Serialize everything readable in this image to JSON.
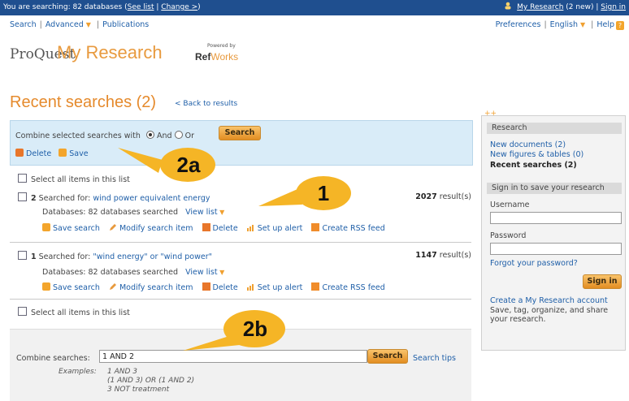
{
  "topbar": {
    "searching_text": "You are searching: 82 databases",
    "see_list": "See list",
    "sep": "|",
    "change": "Change >",
    "paren_open": "(",
    "paren_close": ")",
    "my_research": "My Research",
    "new_count": "(2 new)",
    "sign_in": "Sign in"
  },
  "nav": {
    "search": "Search",
    "advanced": "Advanced",
    "publications": "Publications",
    "sep": "|"
  },
  "pref": {
    "preferences": "Preferences",
    "english": "English",
    "help": "Help",
    "sep": "|"
  },
  "branding": {
    "proquest": "ProQuest",
    "my_research": "My Research",
    "powered_by": "Powered by",
    "ref": "Ref",
    "works": "Works"
  },
  "page": {
    "title": "Recent searches (2)",
    "back": "< Back to results"
  },
  "combine": {
    "label": "Combine selected searches with",
    "and": "And",
    "or": "Or",
    "search_button": "Search",
    "delete": "Delete",
    "save": "Save"
  },
  "list": {
    "select_all": "Select all items in this list",
    "items": [
      {
        "num": "2",
        "searched_for_label": "Searched for:",
        "query": "wind power equivalent energy",
        "results": "2027",
        "results_suffix": "result(s)",
        "databases": "Databases: 82 databases searched",
        "view_list": "View list"
      },
      {
        "num": "1",
        "searched_for_label": "Searched for:",
        "query": "\"wind energy\" or \"wind power\"",
        "results": "1147",
        "results_suffix": "result(s)",
        "databases": "Databases: 82 databases searched",
        "view_list": "View list"
      }
    ],
    "actions": {
      "save_search": "Save search",
      "modify": "Modify search item",
      "delete": "Delete",
      "alert": "Set up alert",
      "rss": "Create RSS feed"
    }
  },
  "bottom": {
    "combine_label": "Combine searches:",
    "input_value": "1 AND 2",
    "search_button": "Search",
    "tips": "Search tips",
    "examples_label": "Examples:",
    "examples": [
      "1 AND 3",
      "(1 AND 3) OR (1 AND 2)",
      "3 NOT treatment"
    ]
  },
  "sidebar": {
    "research_header": "Research",
    "new_documents": "New documents (2)",
    "new_figures": "New figures & tables (0)",
    "recent_searches": "Recent searches (2)",
    "signin_header": "Sign in to save your research",
    "username": "Username",
    "password": "Password",
    "forgot": "Forgot your password?",
    "signin_button": "Sign in",
    "create_account": "Create a My Research account",
    "create_desc": "Save, tag, organize, and share your research."
  },
  "callouts": {
    "c1": "1",
    "c2a": "2a",
    "c2b": "2b"
  },
  "colors": {
    "topbar": "#1f4f8f",
    "accent_orange": "#e89a3e",
    "callout_yellow": "#f5b526",
    "link_blue": "#1f5fa8"
  }
}
